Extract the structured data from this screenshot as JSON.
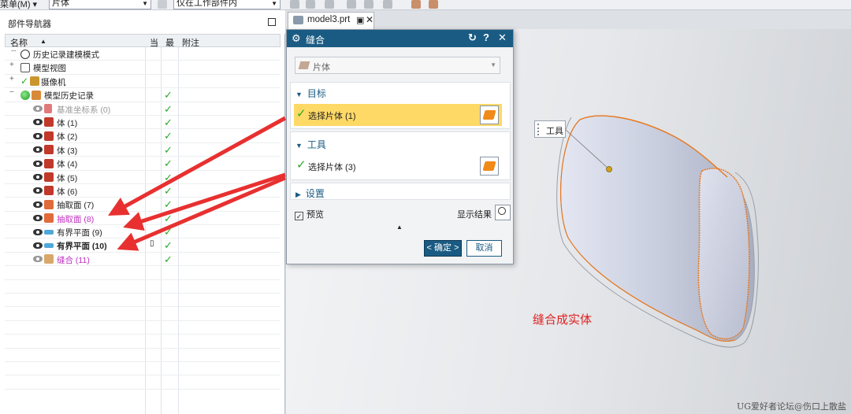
{
  "toolbar": {
    "menu_label": "菜单(M) ▾",
    "filter_value": "片体",
    "scope_value": "仅在工作部件内"
  },
  "navigator": {
    "title": "部件导航器",
    "columns": {
      "name": "名称",
      "sort": "▲",
      "current": "当",
      "latest": "最",
      "notes": "附注"
    },
    "items": [
      {
        "label": "历史记录建模模式",
        "level": 1
      },
      {
        "label": "模型视图",
        "level": 1
      },
      {
        "label": "摄像机",
        "level": 1
      },
      {
        "label": "模型历史记录",
        "level": 1
      },
      {
        "label": "基准坐标系 (0)",
        "level": 2
      },
      {
        "label": "体 (1)",
        "level": 2
      },
      {
        "label": "体 (2)",
        "level": 2
      },
      {
        "label": "体 (3)",
        "level": 2
      },
      {
        "label": "体 (4)",
        "level": 2
      },
      {
        "label": "体 (5)",
        "level": 2
      },
      {
        "label": "体 (6)",
        "level": 2
      },
      {
        "label": "抽取面 (7)",
        "level": 2
      },
      {
        "label": "抽取面 (8)",
        "level": 2
      },
      {
        "label": "有界平面 (9)",
        "level": 2
      },
      {
        "label": "有界平面 (10)",
        "level": 2
      },
      {
        "label": "缝合 (11)",
        "level": 2
      }
    ]
  },
  "graphics": {
    "tab_label": "model3.prt"
  },
  "dialog": {
    "title": "缝合",
    "type_value": "片体",
    "target_section": "目标",
    "target_pick": "选择片体 (1)",
    "tool_section": "工具",
    "tool_pick": "选择片体 (3)",
    "settings_section": "设置",
    "preview_label": "预览",
    "show_result_label": "显示结果",
    "ok_label": "< 确定 >",
    "cancel_label": "取消"
  },
  "viewport": {
    "tool_tooltip": "工具",
    "annotation": "缝合成实体",
    "watermark": "UG爱好者论坛@伤口上散盐"
  },
  "colors": {
    "accent": "#1a5b83",
    "highlight": "#ffd966",
    "arrow": "#e83030",
    "check": "#2aa82a"
  }
}
